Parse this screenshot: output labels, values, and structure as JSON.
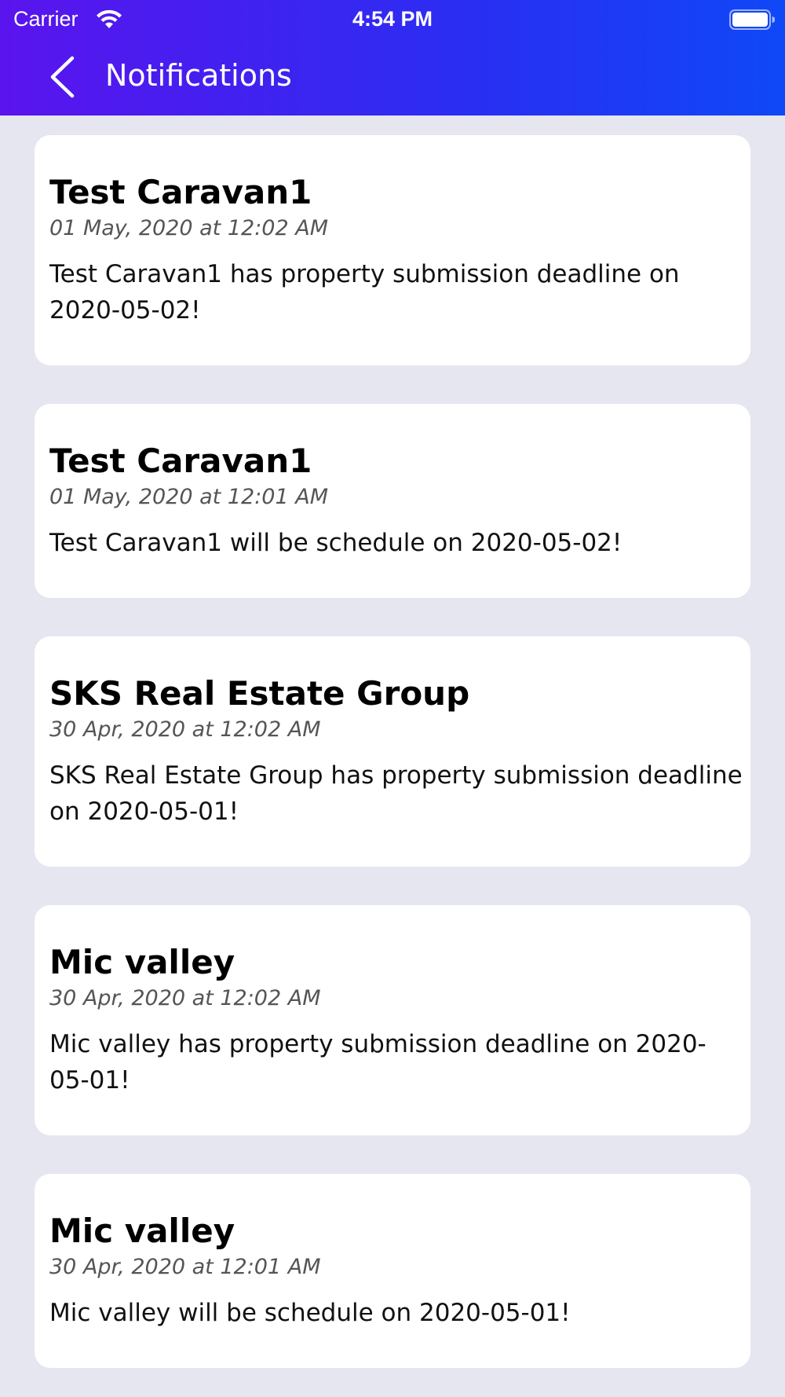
{
  "status_bar": {
    "carrier": "Carrier",
    "time": "4:54 PM"
  },
  "nav": {
    "title": "Notifications",
    "back_icon": "chevron-left-icon"
  },
  "colors": {
    "header_gradient_start": "#5a14ee",
    "header_gradient_end": "#0f48f7",
    "background": "#e6e6f0",
    "card": "#ffffff"
  },
  "notifications": [
    {
      "title": "Test Caravan1",
      "date": "01 May, 2020 at 12:02 AM",
      "body": "Test Caravan1 has property submission deadline on 2020-05-02!"
    },
    {
      "title": "Test Caravan1",
      "date": "01 May, 2020 at 12:01 AM",
      "body": "Test Caravan1 will be schedule on 2020-05-02!"
    },
    {
      "title": "SKS Real Estate Group",
      "date": "30 Apr, 2020 at 12:02 AM",
      "body": "SKS Real Estate Group has property submission deadline on 2020-05-01!"
    },
    {
      "title": "Mic valley",
      "date": "30 Apr, 2020 at 12:02 AM",
      "body": "Mic valley has property submission deadline on 2020-05-01!"
    },
    {
      "title": "Mic valley",
      "date": "30 Apr, 2020 at 12:01 AM",
      "body": "Mic valley will be schedule on 2020-05-01!"
    }
  ]
}
